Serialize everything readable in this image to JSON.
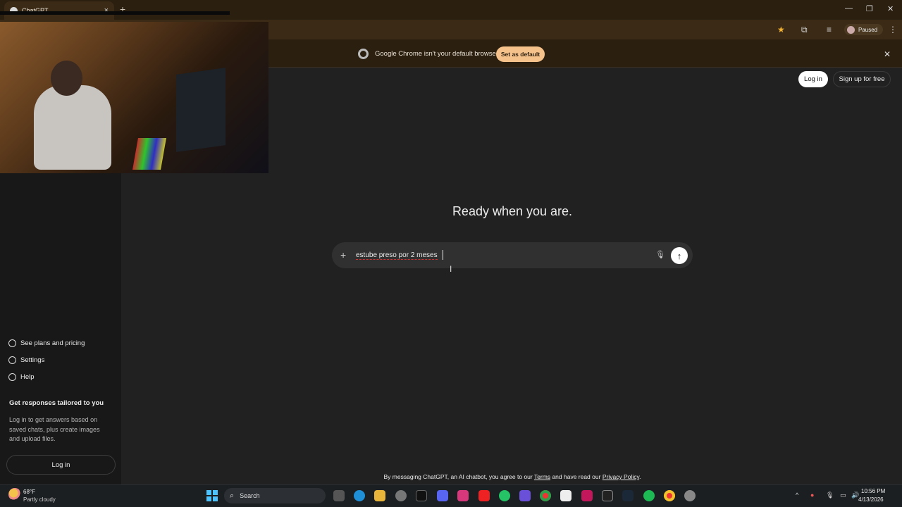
{
  "browser": {
    "tab_title": "ChatGPT",
    "profile_status": "Paused",
    "infobar_text": "Google Chrome isn't your default browser",
    "infobar_button": "Set as default"
  },
  "header": {
    "login_label": "Log in",
    "signup_label": "Sign up for free"
  },
  "sidebar": {
    "items": [
      {
        "label": "See plans and pricing",
        "icon": "plans-icon"
      },
      {
        "label": "Settings",
        "icon": "gear-icon"
      },
      {
        "label": "Help",
        "icon": "help-icon"
      }
    ],
    "tailored_title": "Get responses tailored to you",
    "tailored_text": "Log in to get answers based on saved chats, plus create images and upload files.",
    "login_label": "Log in"
  },
  "main": {
    "headline": "Ready when you are.",
    "prompt_value": "estube preso por 2 meses",
    "footer_prefix": "By messaging ChatGPT, an AI chatbot, you agree to our ",
    "footer_terms": "Terms",
    "footer_mid": " and have read our ",
    "footer_privacy": "Privacy Policy",
    "footer_suffix": "."
  },
  "taskbar": {
    "weather_temp": "68°F",
    "weather_desc": "Partly cloudy",
    "search_label": "Search",
    "time": "10:56 PM",
    "date": "4/13/2026"
  },
  "colors": {
    "background": "#212121",
    "sidebar": "#181818",
    "composer": "#303030",
    "set_default_button": "#f6c28b",
    "windows_accent": "#4cc2ff"
  }
}
